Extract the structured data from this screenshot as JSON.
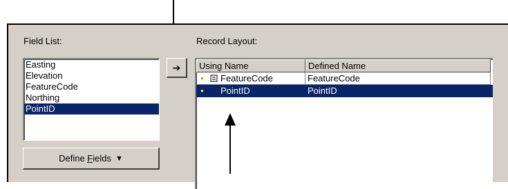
{
  "field_list": {
    "label": "Field List:",
    "items": [
      "Easting",
      "Elevation",
      "FeatureCode",
      "Northing",
      "PointID"
    ],
    "selected_index": 4
  },
  "add_button": {
    "icon": "right-arrow-icon",
    "glyph": "➔"
  },
  "define_fields": {
    "label_prefix": "Define ",
    "label_mnemonic": "F",
    "label_suffix": "ields",
    "triangle": "▼"
  },
  "record_layout": {
    "label": "Record Layout:",
    "columns": [
      "Using Name",
      "Defined Name"
    ],
    "rows": [
      {
        "using_name": "FeatureCode",
        "defined_name": "FeatureCode"
      },
      {
        "using_name": "PointID",
        "defined_name": "PointID"
      }
    ],
    "selected_index": 1
  },
  "colors": {
    "selection": "#0a246a",
    "dialog_bg": "#d4d0c8"
  }
}
